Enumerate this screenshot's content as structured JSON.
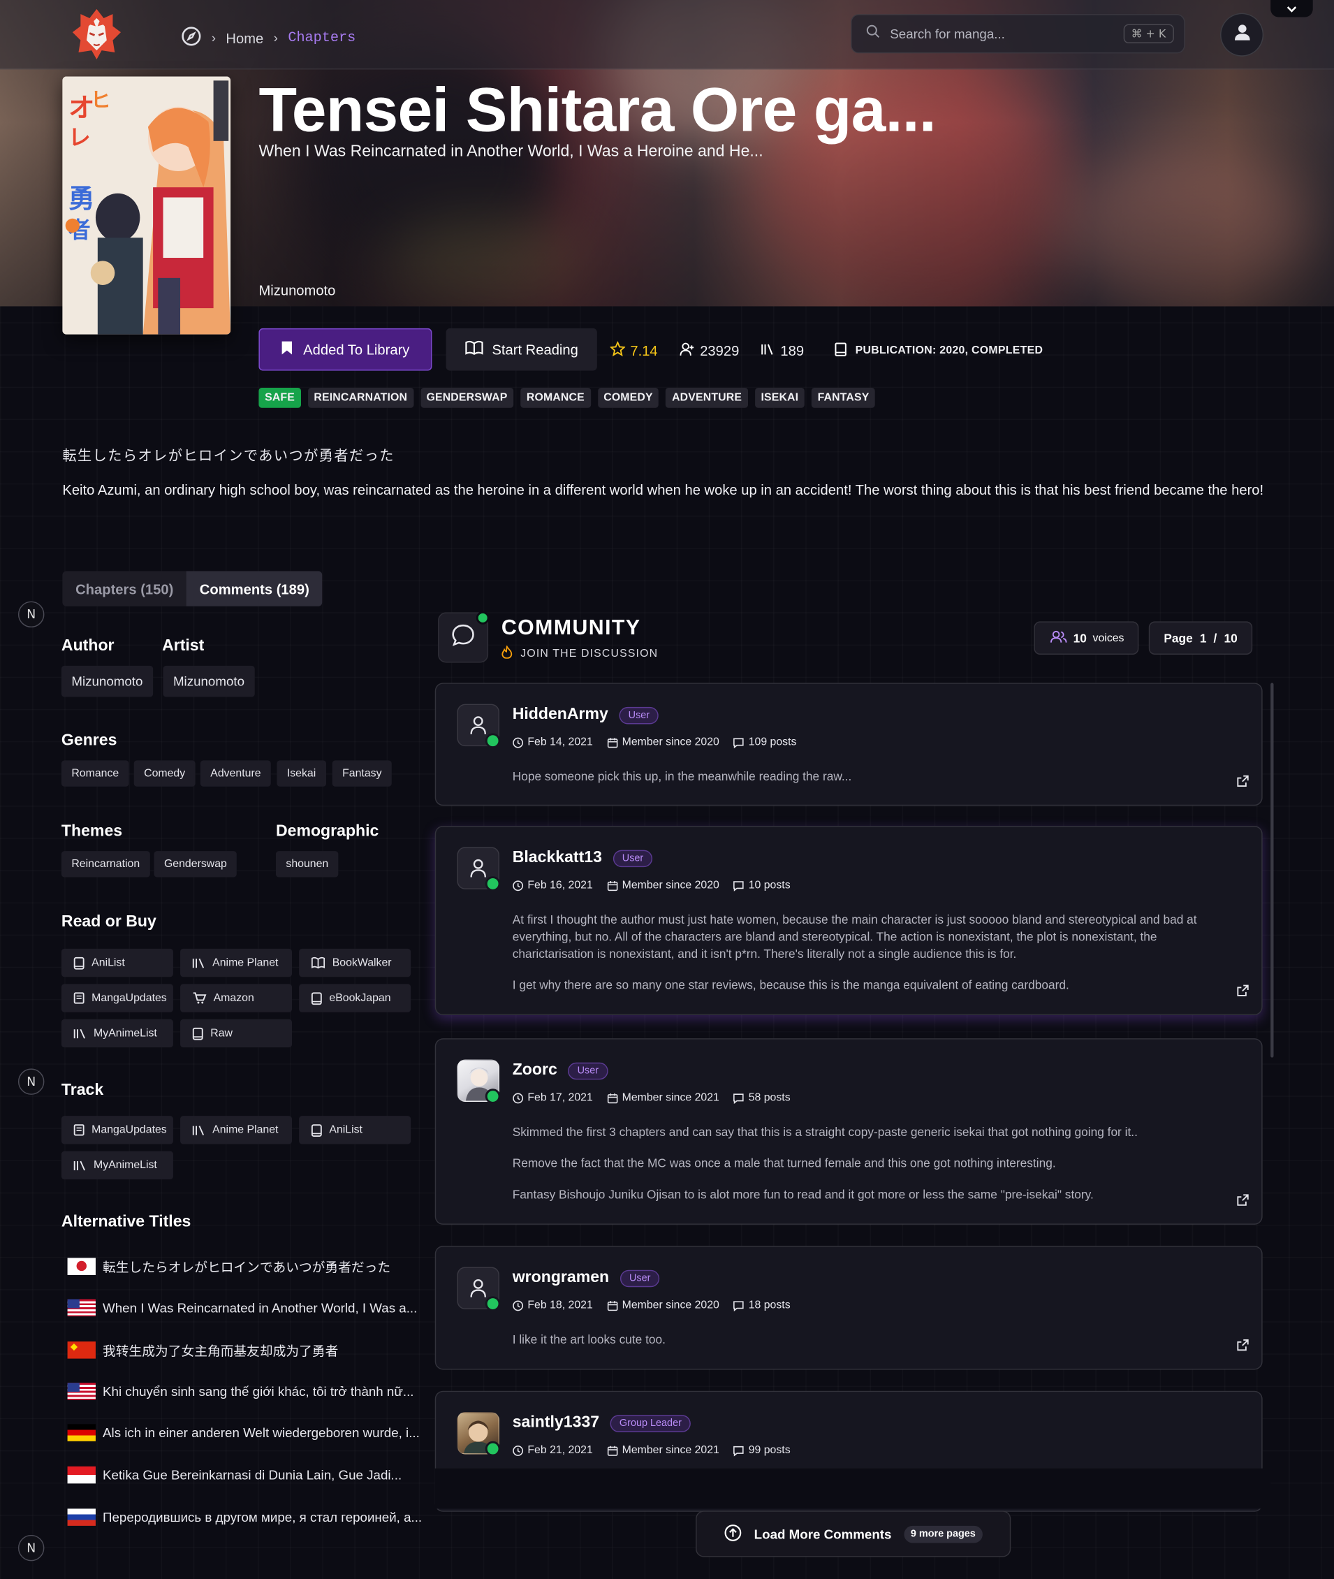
{
  "nav": {
    "breadcrumb_home": "Home",
    "breadcrumb_sep": "›",
    "breadcrumb_current": "Chapters",
    "search_placeholder": "Search for manga...",
    "search_shortcut": "⌘ + K"
  },
  "manga": {
    "title": "Tensei Shitara Ore ga...",
    "subtitle": "When I Was Reincarnated in Another World, I Was a Heroine and He...",
    "author": "Mizunomoto",
    "add_library_label": "Added To Library",
    "start_reading_label": "Start Reading",
    "rating": "7.14",
    "follows": "23929",
    "comments_count": "189",
    "publication": "PUBLICATION: 2020, COMPLETED",
    "tags": [
      "SAFE",
      "REINCARNATION",
      "GENDERSWAP",
      "ROMANCE",
      "COMEDY",
      "ADVENTURE",
      "ISEKAI",
      "FANTASY"
    ],
    "description_jp": "転生したらオレがヒロインであいつが勇者だった",
    "description": "Keito Azumi, an ordinary high school boy, was reincarnated as the heroine in a different world when he woke up in an accident! The worst thing about this is that his best friend became the hero!"
  },
  "tabs": {
    "chapters": "Chapters (150)",
    "comments": "Comments (189)"
  },
  "badge_letter": "N",
  "sidebar": {
    "author_heading": "Author",
    "author": "Mizunomoto",
    "artist_heading": "Artist",
    "artist": "Mizunomoto",
    "genres_heading": "Genres",
    "genres": [
      "Romance",
      "Comedy",
      "Adventure",
      "Isekai",
      "Fantasy"
    ],
    "themes_heading": "Themes",
    "themes": [
      "Reincarnation",
      "Genderswap"
    ],
    "demographic_heading": "Demographic",
    "demographic": "shounen",
    "readbuy_heading": "Read or Buy",
    "readbuy": [
      "AniList",
      "Anime Planet",
      "BookWalker",
      "MangaUpdates",
      "Amazon",
      "eBookJapan",
      "MyAnimeList",
      "Raw"
    ],
    "track_heading": "Track",
    "track": [
      "MangaUpdates",
      "Anime Planet",
      "AniList",
      "MyAnimeList"
    ],
    "alt_heading": "Alternative Titles",
    "alt_titles": [
      "転生したらオレがヒロインであいつが勇者だった",
      "When I Was Reincarnated in Another World, I Was a...",
      "我转生成为了女主角而基友却成为了勇者",
      "Khi chuyển sinh sang thế giới khác, tôi trở thành nữ...",
      "Als ich in einer anderen Welt wiedergeboren wurde, i...",
      "Ketika Gue Bereinkarnasi di Dunia Lain, Gue Jadi...",
      "Переродившись в другом мире, я стал героиней, а..."
    ]
  },
  "community": {
    "title": "COMMUNITY",
    "subtitle": "JOIN THE DISCUSSION",
    "voices_count": "10",
    "voices_label": "voices",
    "page_label": "Page",
    "page_current": "1",
    "page_sep": "/",
    "page_total": "10",
    "load_more": "Load More Comments",
    "more_pages": "9 more pages"
  },
  "comments": [
    {
      "user": "HiddenArmy",
      "role": "User",
      "date": "Feb 14, 2021",
      "since": "Member since 2020",
      "posts": "109 posts",
      "body": [
        "Hope someone pick this up, in the meanwhile reading the raw..."
      ]
    },
    {
      "user": "Blackkatt13",
      "role": "User",
      "date": "Feb 16, 2021",
      "since": "Member since 2020",
      "posts": "10 posts",
      "body": [
        "At first I thought the author must just hate women, because the main character is just sooooo bland and stereotypical and bad at everything, but no. All of the characters are bland and stereotypical. The action is nonexistant, the plot is nonexistant, the charictarisation is nonexistant, and it isn't p*rn. There's literally not a single audience this is for.",
        "I get why there are so many one star reviews, because this is the manga equivalent of eating cardboard."
      ]
    },
    {
      "user": "Zoorc",
      "role": "User",
      "date": "Feb 17, 2021",
      "since": "Member since 2021",
      "posts": "58 posts",
      "body": [
        "Skimmed the first 3 chapters and can say that this is a straight copy-paste generic isekai that got nothing going for it..",
        "Remove the fact that the MC was once a male that turned female and this one got nothing interesting.",
        "Fantasy Bishoujo Juniku Ojisan to is alot more fun to read and it got more or less the same \"pre-isekai\" story."
      ]
    },
    {
      "user": "wrongramen",
      "role": "User",
      "date": "Feb 18, 2021",
      "since": "Member since 2020",
      "posts": "18 posts",
      "body": [
        "I like it the art looks cute too."
      ]
    },
    {
      "user": "saintly1337",
      "role": "Group Leader",
      "date": "Feb 21, 2021",
      "since": "Member since 2021",
      "posts": "99 posts",
      "body": []
    }
  ],
  "colors": {
    "accent": "#7d4ad0",
    "online": "#22c55e",
    "safe": "#16a34a",
    "rating": "#f5c518"
  }
}
